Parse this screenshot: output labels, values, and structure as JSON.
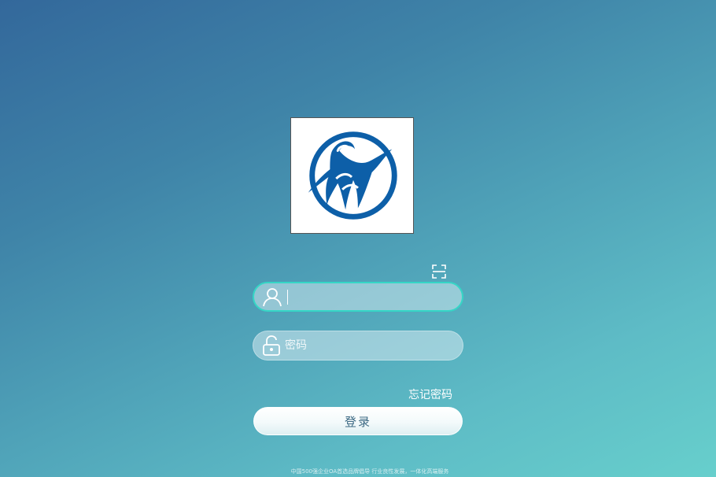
{
  "logo": {
    "icon": "dolphin-emblem-logo",
    "color": "#0d5fa8"
  },
  "scan": {
    "icon": "scan-code-icon"
  },
  "username": {
    "icon": "user-icon",
    "value": "",
    "placeholder": ""
  },
  "password": {
    "icon": "unlock-icon",
    "value": "",
    "placeholder": "密码"
  },
  "forgot_password": "忘记密码",
  "login_button": "登录",
  "footer": "中国500强企业OA首选品牌倡导 行业良性发展，一体化高端服务",
  "colors": {
    "bg_start": "#33689b",
    "bg_end": "#67cfcc",
    "focus_border": "#35d6c6",
    "button_text": "#3d6a84"
  }
}
